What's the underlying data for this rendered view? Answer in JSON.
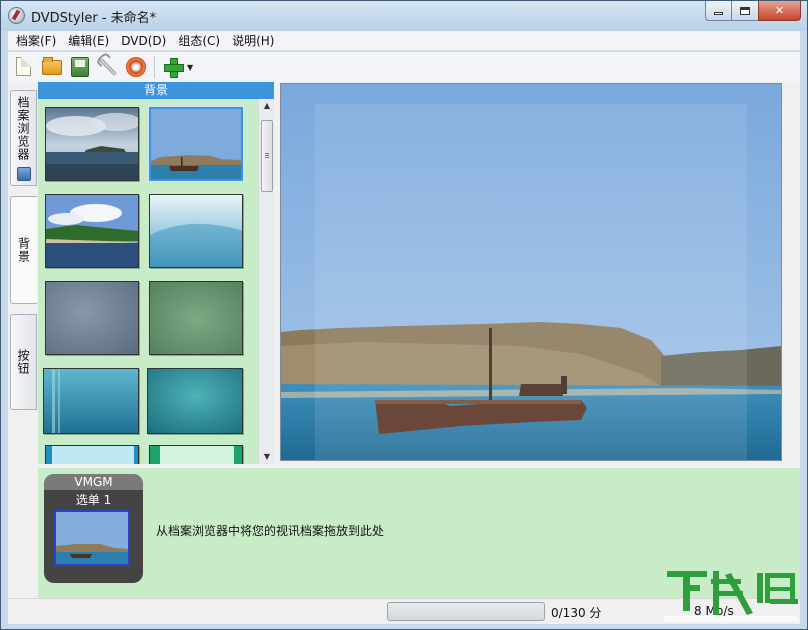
{
  "window": {
    "title": "DVDStyler - 未命名*",
    "controls": {
      "minimize": "minimize",
      "maximize": "maximize",
      "close": "✕"
    }
  },
  "menu": [
    "档案(F)",
    "编辑(E)",
    "DVD(D)",
    "组态(C)",
    "说明(H)"
  ],
  "toolbar": {
    "buttons": [
      "new-icon",
      "open-folder-icon",
      "save-icon",
      "settings-wrench-icon",
      "burn-disc-icon",
      "add-plus-icon"
    ],
    "dropdown": "▼"
  },
  "side_tabs": [
    "档案浏览器",
    "背景",
    "按钮"
  ],
  "panel": {
    "header": "背景",
    "thumbnails": [
      "sea-island",
      "ship-wreck",
      "lake-shore",
      "blue-gradient",
      "slate-blur",
      "green-blur",
      "teal-stripes",
      "teal-water",
      "cyan-bar",
      "mint-bar"
    ],
    "selected": "ship-wreck"
  },
  "scrollbar": {
    "up": "▲",
    "down": "▼"
  },
  "titleset": {
    "vmgm_label": "VMGM",
    "menu_label": "选单 1",
    "drop_hint": "从档案浏览器中将您的视讯档案拖放到此处"
  },
  "status": {
    "progress_percent": 0,
    "time": "0/130 分",
    "rate": "8 Mb/s"
  },
  "watermark": {
    "text": "下载吧"
  },
  "colors": {
    "panel_bg": "#c9ecc8",
    "header_blue": "#3d94de",
    "sky": "#8fb4e0",
    "sea": "#2d7faf"
  }
}
